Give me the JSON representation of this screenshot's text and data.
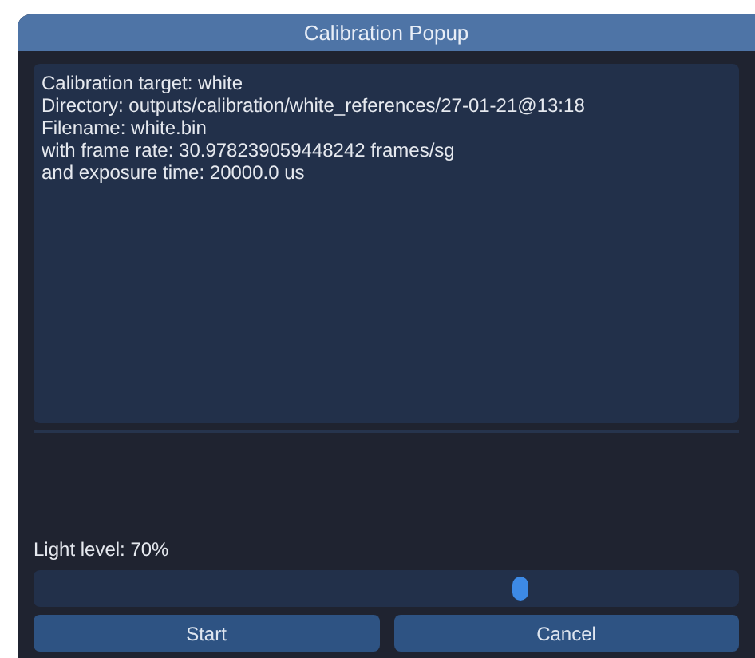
{
  "window": {
    "title": "Calibration Popup"
  },
  "log_lines": [
    "Calibration target: white",
    "Directory: outputs/calibration/white_references/27-01-21@13:18",
    "Filename: white.bin",
    "with frame rate: 30.978239059448242 frames/sg",
    "and exposure time: 20000.0 us"
  ],
  "light": {
    "label": "Light level: 70%",
    "level": 0.69
  },
  "buttons": [
    "Start",
    "Cancel"
  ]
}
